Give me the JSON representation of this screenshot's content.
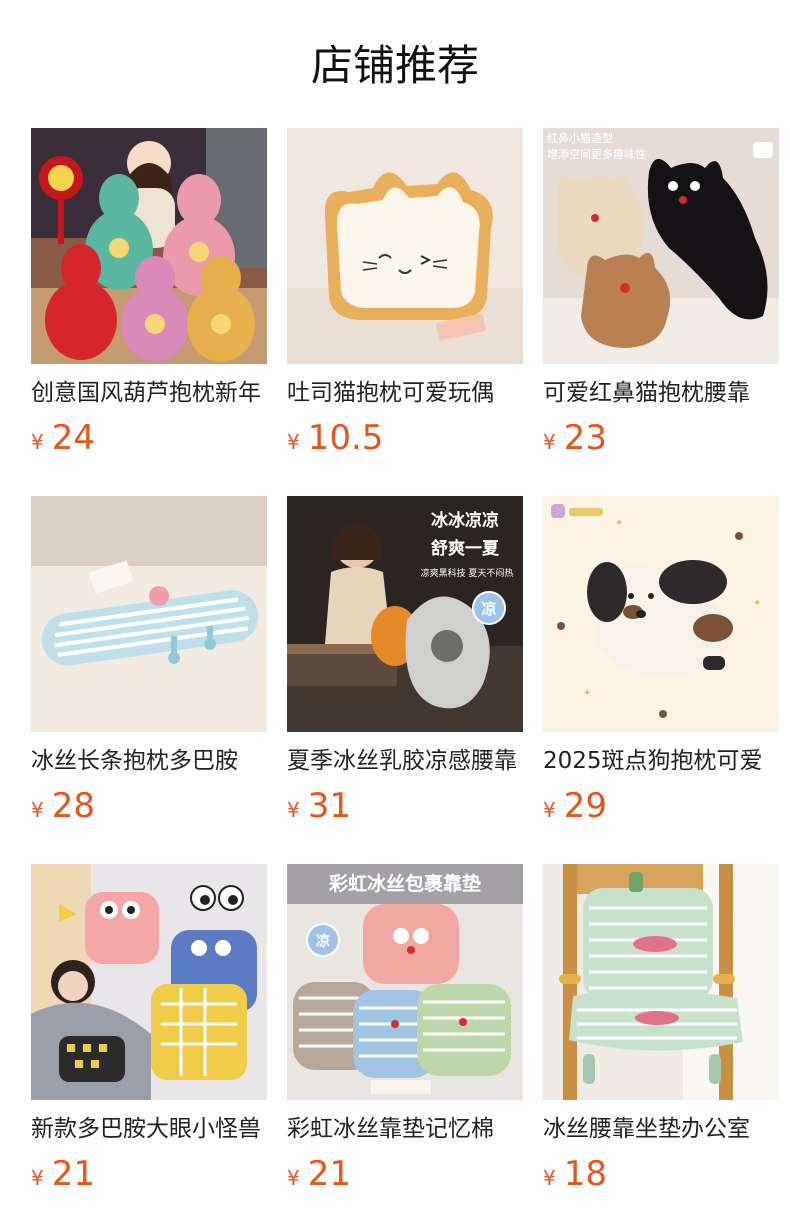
{
  "section": {
    "title": "店铺推荐"
  },
  "products": [
    {
      "name": "创意国风葫芦抱枕新年",
      "currency": "¥",
      "price": "24",
      "icon": "gourd-pillow-image"
    },
    {
      "name": "吐司猫抱枕可爱玩偶",
      "currency": "¥",
      "price": "10.5",
      "icon": "toast-cat-pillow-image"
    },
    {
      "name": "可爱红鼻猫抱枕腰靠",
      "currency": "¥",
      "price": "23",
      "icon": "red-nose-cat-pillow-image",
      "image_text": [
        "红鼻小猫造型",
        "增添空间更多趣味性"
      ]
    },
    {
      "name": "冰丝长条抱枕多巴胺",
      "currency": "¥",
      "price": "28",
      "icon": "long-bolster-pillow-image"
    },
    {
      "name": "夏季冰丝乳胶凉感腰靠",
      "currency": "¥",
      "price": "31",
      "icon": "ice-silk-lumbar-image",
      "image_text": [
        "冰冰凉凉",
        "舒爽一夏",
        "凉爽黑科技 夏天不闷热",
        "凉"
      ]
    },
    {
      "name": "2025斑点狗抱枕可爱",
      "currency": "¥",
      "price": "29",
      "icon": "spotted-dog-pillow-image"
    },
    {
      "name": "新款多巴胺大眼小怪兽",
      "currency": "¥",
      "price": "21",
      "icon": "big-eye-monster-pillow-image"
    },
    {
      "name": "彩虹冰丝靠垫记忆棉",
      "currency": "¥",
      "price": "21",
      "icon": "rainbow-cushion-image",
      "image_text": [
        "彩虹冰丝包裹靠垫",
        "凉"
      ]
    },
    {
      "name": "冰丝腰靠坐垫办公室",
      "currency": "¥",
      "price": "18",
      "icon": "seat-cushion-chair-image"
    }
  ]
}
